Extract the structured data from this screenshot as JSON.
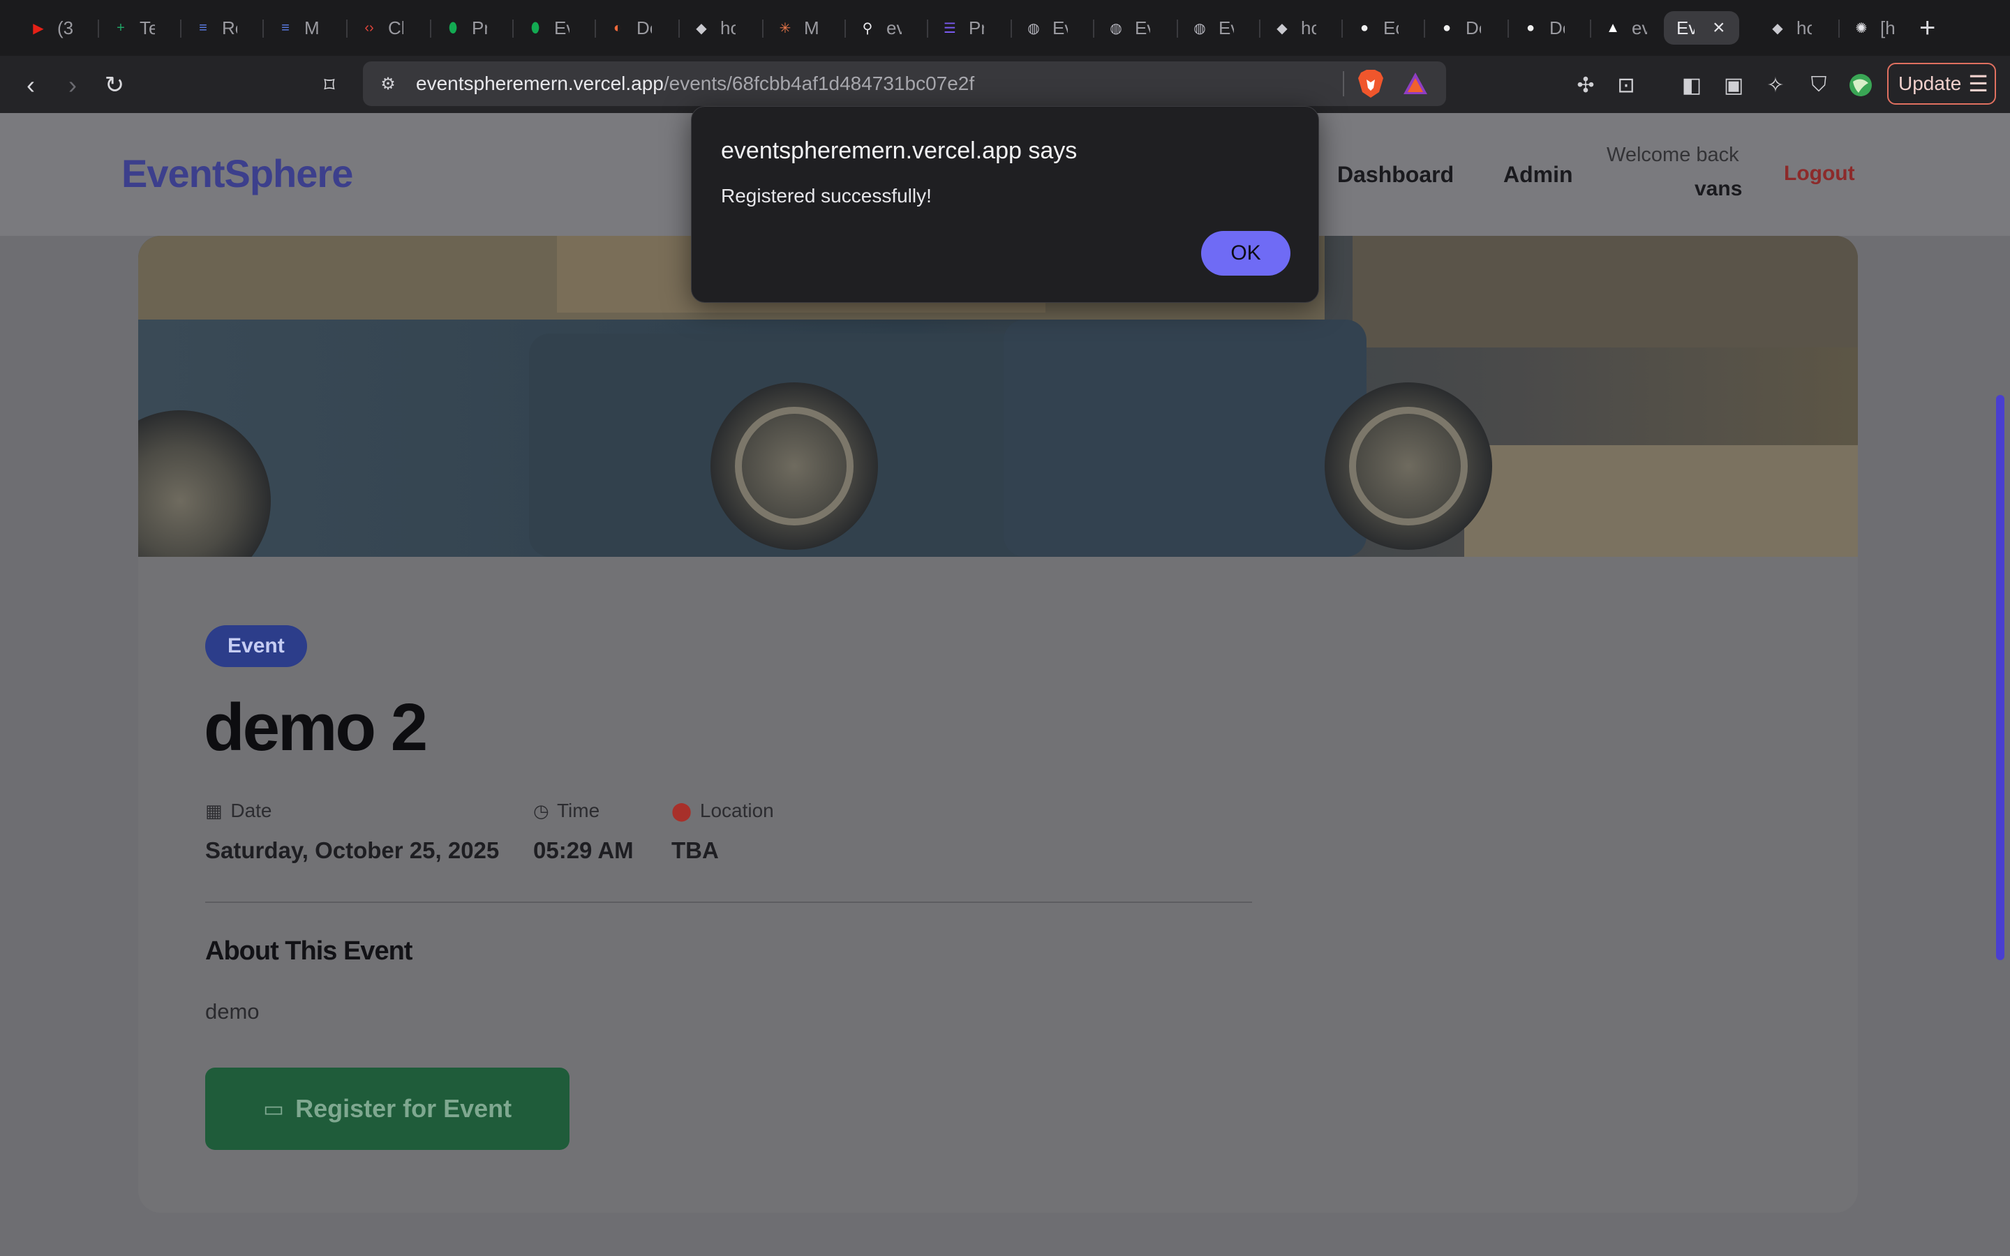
{
  "browser": {
    "tabs": [
      {
        "fav": "youtube-icon",
        "glyph": "▶",
        "color": "#e62117",
        "label": "(3"
      },
      {
        "fav": "sheets-icon",
        "glyph": "+",
        "color": "#21a366",
        "label": "Te"
      },
      {
        "fav": "doc-icon",
        "glyph": "≡",
        "color": "#5b7de8",
        "label": "Re"
      },
      {
        "fav": "doc-icon",
        "glyph": "≡",
        "color": "#5b7de8",
        "label": "M"
      },
      {
        "fav": "code-icon",
        "glyph": "‹›",
        "color": "#e0443a",
        "label": "Cl"
      },
      {
        "fav": "leaf-icon",
        "glyph": "⬮",
        "color": "#13aa52",
        "label": "Pr"
      },
      {
        "fav": "leaf-icon",
        "glyph": "⬮",
        "color": "#13aa52",
        "label": "Ev"
      },
      {
        "fav": "dev-icon",
        "glyph": "◐",
        "color": "#f26a3c",
        "label": "De"
      },
      {
        "fav": "brave-icon",
        "glyph": "◆",
        "color": "#c9c9cf",
        "label": "ho"
      },
      {
        "fav": "sparkle-icon",
        "glyph": "✳",
        "color": "#e8774a",
        "label": "M"
      },
      {
        "fav": "link-icon",
        "glyph": "⚲",
        "color": "#e8e8ec",
        "label": "ev"
      },
      {
        "fav": "list-icon",
        "glyph": "☰",
        "color": "#7a5af0",
        "label": "Pr"
      },
      {
        "fav": "globe-icon",
        "glyph": "◍",
        "color": "#b8b8c0",
        "label": "Ev"
      },
      {
        "fav": "globe-icon",
        "glyph": "◍",
        "color": "#b8b8c0",
        "label": "Ev"
      },
      {
        "fav": "globe-icon",
        "glyph": "◍",
        "color": "#b8b8c0",
        "label": "Ev"
      },
      {
        "fav": "brave-icon",
        "glyph": "◆",
        "color": "#c9c9cf",
        "label": "ho"
      },
      {
        "fav": "github-icon",
        "glyph": "●",
        "color": "#f0f0f0",
        "label": "Ec"
      },
      {
        "fav": "github-icon",
        "glyph": "●",
        "color": "#f0f0f0",
        "label": "De"
      },
      {
        "fav": "github-icon",
        "glyph": "●",
        "color": "#f0f0f0",
        "label": "De"
      },
      {
        "fav": "vercel-icon",
        "glyph": "▲",
        "color": "#ffffff",
        "label": "ev"
      },
      {
        "fav": "none",
        "glyph": "",
        "color": "#e6e6ea",
        "label": "Ev",
        "active": true
      },
      {
        "fav": "brave-icon",
        "glyph": "◆",
        "color": "#c9c9cf",
        "label": "ho"
      },
      {
        "fav": "bug-icon",
        "glyph": "✺",
        "color": "#e8e8ec",
        "label": "[h"
      }
    ],
    "url_host": "eventspheremern.vercel.app",
    "url_path": "/events/68fcbb4af1d484731bc07e2f",
    "update_label": "Update"
  },
  "site": {
    "logo": "EventSphere",
    "nav": {
      "dashboard": "Dashboard",
      "admin": "Admin"
    },
    "welcome": "Welcome back",
    "username": "vans",
    "logout": "Logout"
  },
  "event": {
    "badge": "Event",
    "title": "demo 2",
    "date_label": "Date",
    "date_value": "Saturday, October 25, 2025",
    "time_label": "Time",
    "time_value": "05:29 AM",
    "location_label": "Location",
    "location_value": "TBA",
    "about_heading": "About This Event",
    "about_text": "demo",
    "register_label": "Register for Event"
  },
  "dialog": {
    "title": "eventspheremern.vercel.app says",
    "message": "Registered successfully!",
    "ok_label": "OK"
  }
}
